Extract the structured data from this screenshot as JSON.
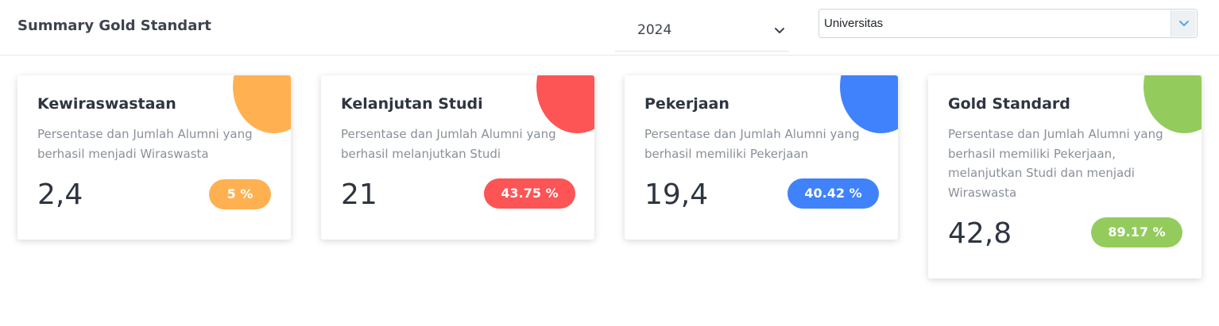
{
  "header": {
    "title": "Summary Gold Standart",
    "year_select": {
      "value": "2024"
    },
    "unit_select": {
      "value": "Universitas"
    }
  },
  "colors": {
    "orange": "#ffb152",
    "red": "#fd5455",
    "blue": "#3f82fb",
    "green": "#93cc5d"
  },
  "cards": [
    {
      "title": "Kewiraswastaan",
      "description": "Persentase dan Jumlah Alumni yang berhasil menjadi Wiraswasta",
      "value": "2,4",
      "percentage": "5 %",
      "icon": "briefcase-icon",
      "color": "#ffb152"
    },
    {
      "title": "Kelanjutan Studi",
      "description": "Persentase dan Jumlah Alumni yang berhasil melanjutkan Studi",
      "value": "21",
      "percentage": "43.75 %",
      "icon": "graduation-cap-icon",
      "color": "#fd5455"
    },
    {
      "title": "Pekerjaan",
      "description": "Persentase dan Jumlah Alumni yang berhasil memiliki Pekerjaan",
      "value": "19,4",
      "percentage": "40.42 %",
      "icon": "money-bill-icon",
      "color": "#3f82fb"
    },
    {
      "title": "Gold Standard",
      "description": "Persentase dan Jumlah Alumni yang berhasil memiliki Pekerjaan, melanjutkan Studi dan menjadi Wiraswasta",
      "value": "42,8",
      "percentage": "89.17 %",
      "icon": "coins-icon",
      "color": "#93cc5d"
    }
  ]
}
